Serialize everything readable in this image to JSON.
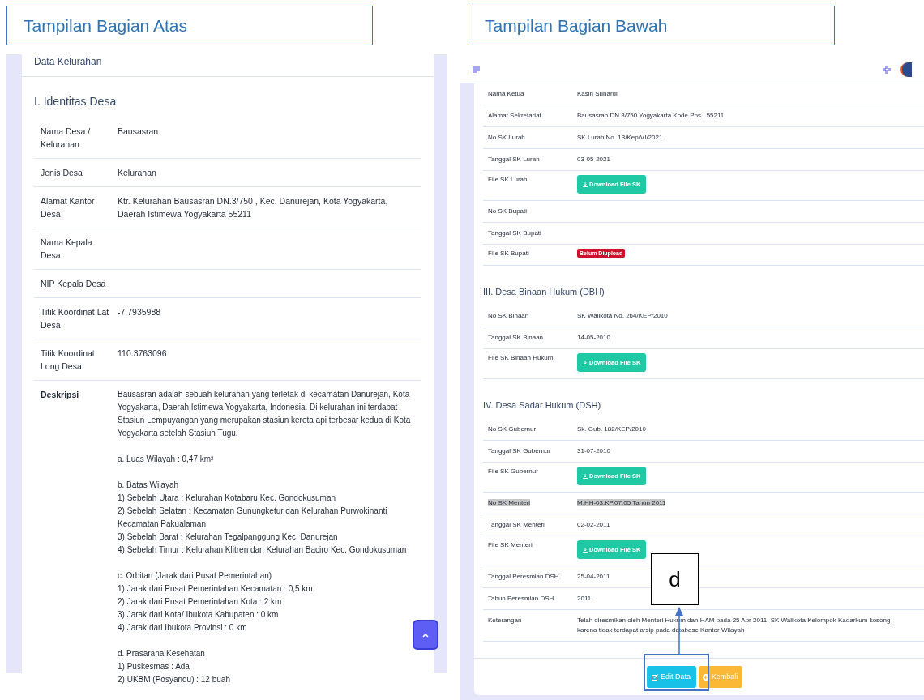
{
  "captions": [
    {
      "text": "Tampilan Bagian Atas"
    },
    {
      "text": "Tampilan Bagian Bawah"
    }
  ],
  "top_view": {
    "card_title": "Data Kelurahan",
    "section_title": "I. Identitas Desa",
    "rows": [
      {
        "label": "Nama Desa / Kelurahan",
        "value": "Bausasran"
      },
      {
        "label": "Jenis Desa",
        "value": "Kelurahan"
      },
      {
        "label": "Alamat Kantor Desa",
        "value": "Ktr. Kelurahan Bausasran DN.3/750 , Kec. Danurejan, Kota Yogyakarta, Daerah Istimewa Yogyakarta 55211"
      },
      {
        "label": "Nama Kepala Desa",
        "value": ""
      },
      {
        "label": "NIP Kepala Desa",
        "value": ""
      },
      {
        "label": "Titik Koordinat Lat Desa",
        "value": "-7.7935988"
      },
      {
        "label": "Titik Koordinat Long Desa",
        "value": "110.3763096"
      }
    ],
    "description": {
      "label": "Deskripsi",
      "paragraphs": [
        [
          "Bausasran adalah sebuah kelurahan yang terletak di kecamatan Danurejan, Kota Yogyakarta, Daerah Istimewa Yogyakarta, Indonesia. Di kelurahan ini terdapat Stasiun Lempuyangan yang merupakan stasiun kereta api terbesar kedua di Kota Yogyakarta setelah Stasiun Tugu."
        ],
        [
          "a. Luas Wilayah : 0,47 km²"
        ],
        [
          "b. Batas Wilayah",
          "1) Sebelah Utara : Kelurahan Kotabaru Kec. Gondokusuman",
          "2) Sebelah Selatan : Kecamatan Gunungketur dan Kelurahan Purwokinanti Kecamatan Pakualaman",
          "3) Sebelah Barat : Kelurahan Tegalpanggung Kec. Danurejan",
          "4) Sebelah Timur : Kelurahan Klitren dan Kelurahan Baciro Kec. Gondokusuman"
        ],
        [
          "c. Orbitan (Jarak dari Pusat Pemerintahan)",
          "1) Jarak dari Pusat Pemerintahan Kecamatan : 0,5 km",
          "2) Jarak dari Pusat Pemerintahan Kota : 2 km",
          "3) Jarak dari Kota/ Ibukota Kabupaten : 0 km",
          "4) Jarak dari Ibukota Provinsi : 0 km"
        ],
        [
          "d. Prasarana Kesehatan",
          "1) Puskesmas : Ada",
          "2) UKBM (Posyandu) : 12 buah"
        ]
      ]
    }
  },
  "bottom_view": {
    "sections": [
      {
        "rows": [
          {
            "label": "Nama Ketua",
            "kind": "text",
            "value": "Kasih Sunardi",
            "highlighted": false
          },
          {
            "label": "Alamat Sekretariat",
            "kind": "text",
            "value": "Bausasran DN 3/750 Yogyakarta Kode Pos : 55211",
            "highlighted": false
          },
          {
            "label": "No SK Lurah",
            "kind": "text",
            "value": "SK Lurah No. 13/Kep/VI/2021",
            "highlighted": false
          },
          {
            "label": "Tanggal SK Lurah",
            "kind": "text",
            "value": "03-05-2021",
            "highlighted": false
          },
          {
            "label": "File SK Lurah",
            "kind": "download",
            "value": "Download File SK",
            "highlighted": false
          },
          {
            "label": "No SK Bupati",
            "kind": "text",
            "value": "",
            "highlighted": false
          },
          {
            "label": "Tanggal SK Bupati",
            "kind": "text",
            "value": "",
            "highlighted": false
          },
          {
            "label": "File SK Bupati",
            "kind": "badge",
            "value": "Belum Diupload",
            "highlighted": false
          }
        ]
      },
      {
        "title": "III. Desa Binaan Hukum (DBH)",
        "rows": [
          {
            "label": "No SK Binaan",
            "kind": "text",
            "value": "SK Walikota No. 264/KEP/2010",
            "highlighted": false
          },
          {
            "label": "Tanggal SK Binaan",
            "kind": "text",
            "value": "14-05-2010",
            "highlighted": false
          },
          {
            "label": "File SK Binaan Hukum",
            "kind": "download",
            "value": "Download File SK",
            "highlighted": false
          }
        ]
      },
      {
        "title": "IV. Desa Sadar Hukum (DSH)",
        "rows": [
          {
            "label": "No SK Gubernur",
            "kind": "text",
            "value": "Sk. Gub. 182/KEP/2010",
            "highlighted": false
          },
          {
            "label": "Tanggal SK Gubernur",
            "kind": "text",
            "value": "31-07-2010",
            "highlighted": false
          },
          {
            "label": "File SK Gubernur",
            "kind": "download",
            "value": "Download File SK",
            "highlighted": false
          },
          {
            "label": "No SK Menteri",
            "kind": "text",
            "value": "M.HH-03.KP.07.05 Tahun 2011",
            "highlighted": true
          },
          {
            "label": "Tanggal SK Menteri",
            "kind": "text",
            "value": "02-02-2011",
            "highlighted": false
          },
          {
            "label": "File SK Menteri",
            "kind": "download",
            "value": "Download File SK",
            "highlighted": false
          },
          {
            "label": "Tanggal Peresmian DSH",
            "kind": "text",
            "value": "25-04-2011",
            "highlighted": false
          },
          {
            "label": "Tahun Peresmian DSH",
            "kind": "text",
            "value": "2011",
            "highlighted": false
          },
          {
            "label": "Keterangan",
            "kind": "text",
            "value": "Telah diresmikan oleh Menteri Hukum dan HAM pada 25 Apr 2011; SK Walikota Kelompok Kadarkum kosong karena tidak terdapat arsip pada database Kantor Wilayah",
            "highlighted": false
          }
        ]
      }
    ],
    "buttons": [
      {
        "label": "Edit Data",
        "kind": "edit"
      },
      {
        "label": "Kembali",
        "kind": "back"
      }
    ]
  },
  "annotation": {
    "label": "d"
  }
}
